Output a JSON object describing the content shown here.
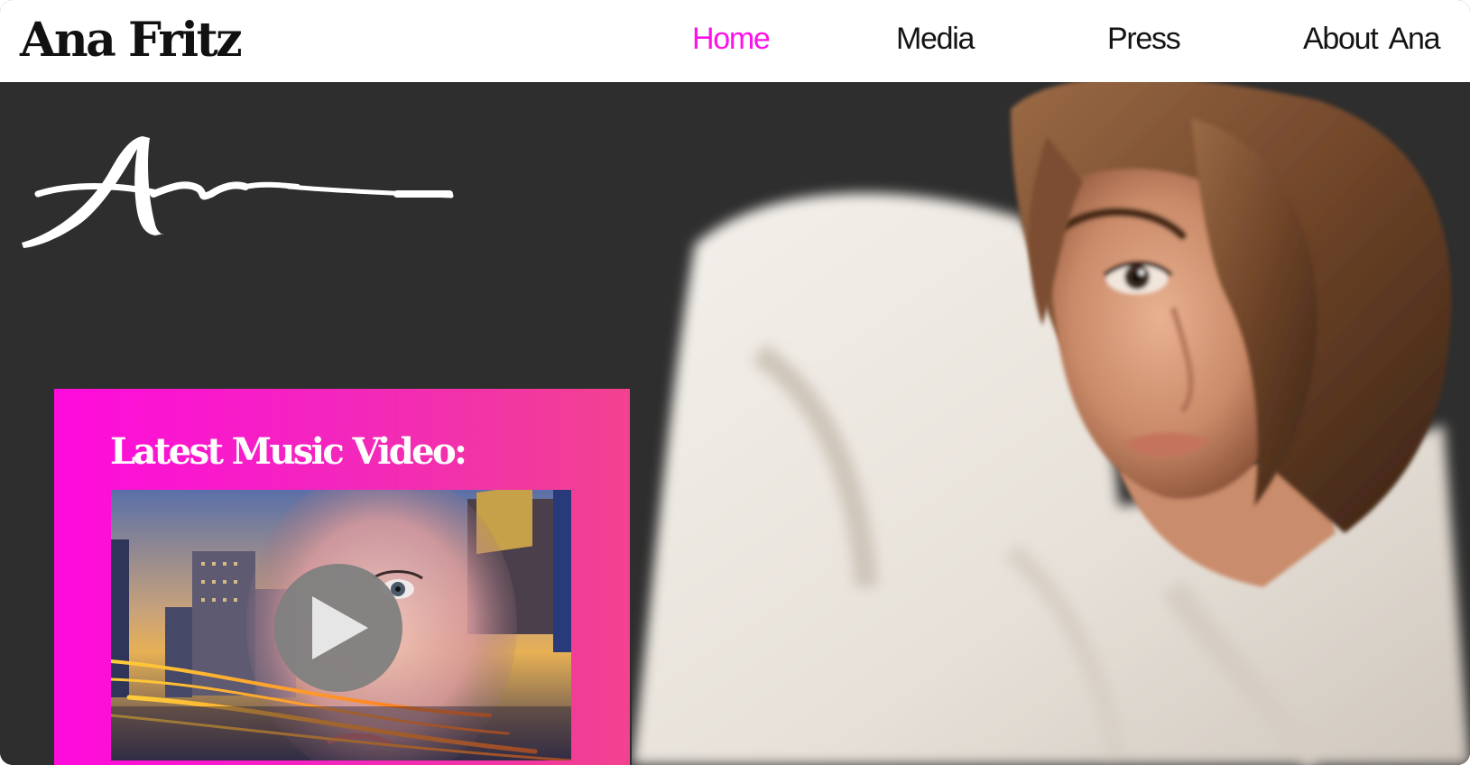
{
  "header": {
    "site_title": "Ana Fritz",
    "nav": [
      {
        "label": "Home",
        "active": true
      },
      {
        "label": "Media",
        "active": false
      },
      {
        "label": "Press",
        "active": false
      },
      {
        "label": "About Ana",
        "active": false
      }
    ]
  },
  "hero": {
    "signature_text": "Ana",
    "photo_alt": "Portrait of Ana Fritz in a white shirt"
  },
  "video_card": {
    "heading": "Latest Music Video:",
    "thumbnail_alt": "Music video thumbnail: city lights collage with a face",
    "play_icon": "play-icon"
  },
  "colors": {
    "accent_pink": "#ff12e8",
    "card_gradient_start": "#ff0bdc",
    "card_gradient_end": "#f2428f",
    "hero_background": "#2e2e2e",
    "header_background": "#ffffff"
  }
}
